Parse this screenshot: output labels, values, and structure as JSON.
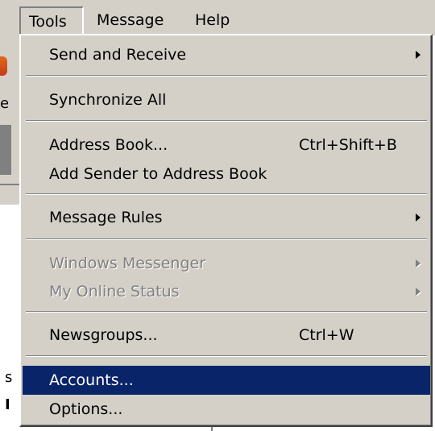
{
  "menubar": {
    "items": [
      {
        "label": "Tools"
      },
      {
        "label": "Message"
      },
      {
        "label": "Help"
      }
    ]
  },
  "background": {
    "fragment_left": "e",
    "fragment_s": "s",
    "fragment_l": "I"
  },
  "dropdown": {
    "items": [
      {
        "label": "Send and Receive",
        "shortcut": "",
        "has_submenu": true,
        "disabled": false,
        "highlighted": false
      },
      {
        "label": "Synchronize All",
        "shortcut": "",
        "has_submenu": false,
        "disabled": false,
        "highlighted": false
      },
      {
        "label": "Address Book...",
        "shortcut": "Ctrl+Shift+B",
        "has_submenu": false,
        "disabled": false,
        "highlighted": false
      },
      {
        "label": "Add Sender to Address Book",
        "shortcut": "",
        "has_submenu": false,
        "disabled": false,
        "highlighted": false
      },
      {
        "label": "Message Rules",
        "shortcut": "",
        "has_submenu": true,
        "disabled": false,
        "highlighted": false
      },
      {
        "label": "Windows Messenger",
        "shortcut": "",
        "has_submenu": true,
        "disabled": true,
        "highlighted": false
      },
      {
        "label": "My Online Status",
        "shortcut": "",
        "has_submenu": true,
        "disabled": true,
        "highlighted": false
      },
      {
        "label": "Newsgroups...",
        "shortcut": "Ctrl+W",
        "has_submenu": false,
        "disabled": false,
        "highlighted": false
      },
      {
        "label": "Accounts...",
        "shortcut": "",
        "has_submenu": false,
        "disabled": false,
        "highlighted": true
      },
      {
        "label": "Options...",
        "shortcut": "",
        "has_submenu": false,
        "disabled": false,
        "highlighted": false
      }
    ]
  },
  "colors": {
    "menu_bg": "#d4d0c8",
    "highlight_bg": "#0a246a",
    "highlight_text": "#ffffff",
    "disabled_text": "#808080"
  },
  "icons": {
    "submenu_arrow": "chevron-right-icon"
  }
}
